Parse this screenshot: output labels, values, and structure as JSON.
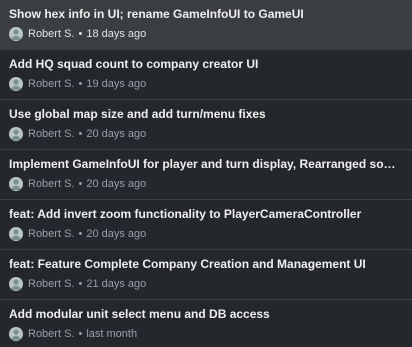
{
  "commits": [
    {
      "title": "Show hex info in UI; rename GameInfoUI to GameUI",
      "author": "Robert S.",
      "separator": "•",
      "time": "18 days ago",
      "selected": true
    },
    {
      "title": "Add HQ squad count to company creator UI",
      "author": "Robert S.",
      "separator": "•",
      "time": "19 days ago",
      "selected": false
    },
    {
      "title": "Use global map size and add turn/menu fixes",
      "author": "Robert S.",
      "separator": "•",
      "time": "20 days ago",
      "selected": false
    },
    {
      "title": "Implement GameInfoUI for player and turn display, Rearranged some t...",
      "author": "Robert S.",
      "separator": "•",
      "time": "20 days ago",
      "selected": false
    },
    {
      "title": "feat: Add invert zoom functionality to PlayerCameraController",
      "author": "Robert S.",
      "separator": "•",
      "time": "20 days ago",
      "selected": false
    },
    {
      "title": "feat: Feature Complete Company Creation and Management UI",
      "author": "Robert S.",
      "separator": "•",
      "time": "21 days ago",
      "selected": false
    },
    {
      "title": "Add modular unit select menu and DB access",
      "author": "Robert S.",
      "separator": "•",
      "time": "last month",
      "selected": false
    }
  ],
  "avatar_icon": "user-avatar-icon",
  "colors": {
    "background": "#24272b",
    "selected_background": "#3a3d42",
    "divider": "#3b3f44",
    "title_text": "#f0f0f0",
    "meta_text": "#9aa0a6"
  }
}
